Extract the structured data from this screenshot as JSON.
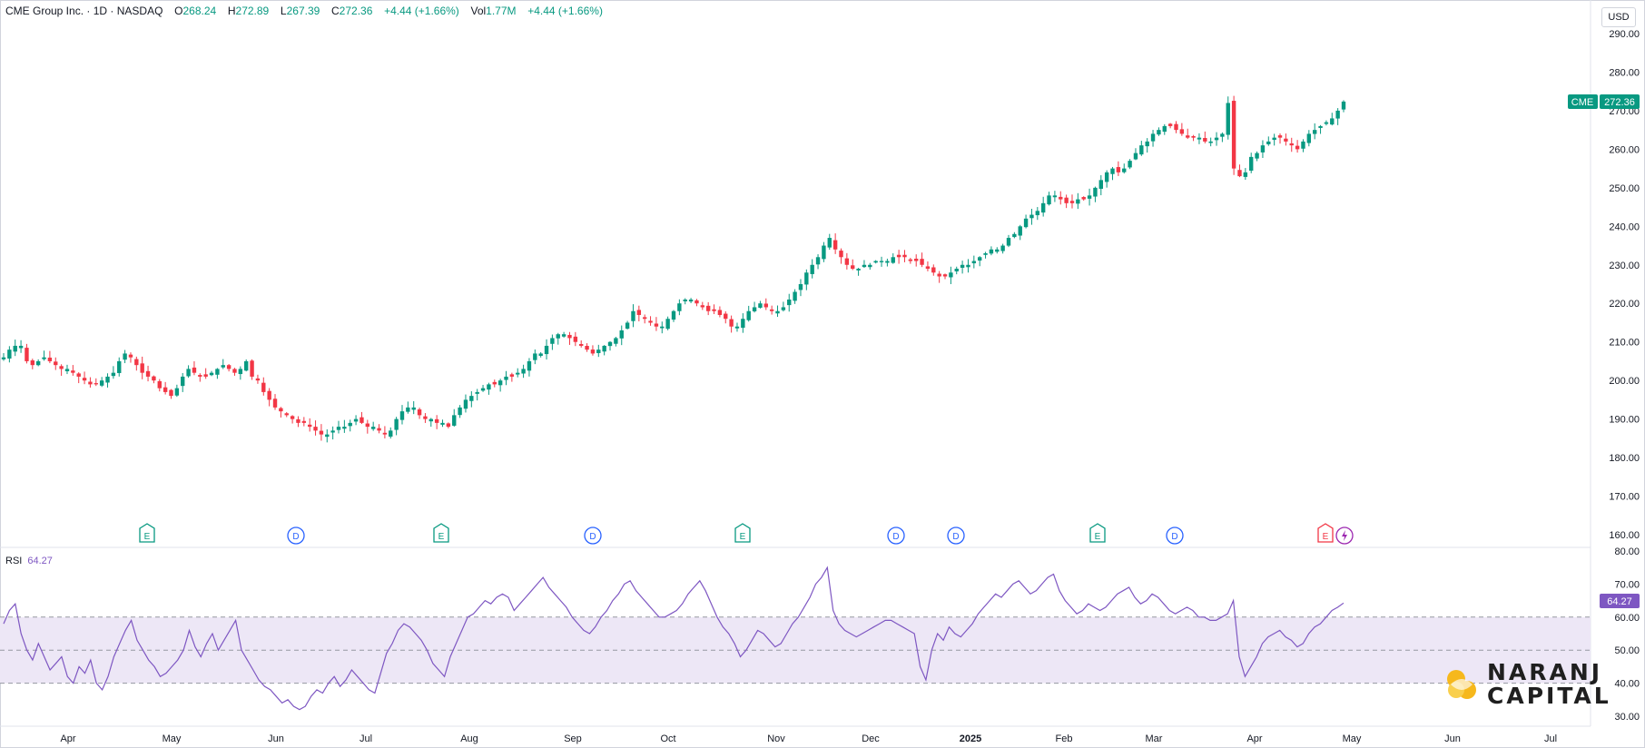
{
  "header": {
    "name": "CME Group Inc.",
    "interval": "1D",
    "exchange": "NASDAQ",
    "open_label": "O",
    "open": "268.24",
    "high_label": "H",
    "high": "272.89",
    "low_label": "L",
    "low": "267.39",
    "close_label": "C",
    "close": "272.36",
    "change": "+4.44 (+1.66%)",
    "vol_label": "Vol",
    "vol": "1.77M",
    "vol_change": "+4.44 (+1.66%)"
  },
  "currency": "USD",
  "ticker_tag": "CME",
  "last_price_label": "272.36",
  "rsi": {
    "label": "RSI",
    "value": "64.27"
  },
  "logo": {
    "line1": "NARANJ",
    "line2": "CAPITAL"
  },
  "colors": {
    "up": "#089981",
    "down": "#f23645",
    "rsi": "#7e57c2",
    "band": "#ede7f6",
    "grid": "#e0e3eb"
  },
  "chart_data": {
    "type": "candlestick",
    "price_axis": {
      "ticks": [
        "290.00",
        "280.00",
        "270.00",
        "260.00",
        "250.00",
        "240.00",
        "230.00",
        "220.00",
        "210.00",
        "200.00",
        "190.00",
        "180.00",
        "170.00",
        "160.00"
      ],
      "range": [
        158,
        292
      ]
    },
    "rsi_axis": {
      "ticks": [
        "80.00",
        "70.00",
        "60.00",
        "50.00",
        "40.00",
        "30.00"
      ],
      "range": [
        27,
        81
      ],
      "levels": [
        60,
        50,
        40
      ]
    },
    "x_labels": [
      "Apr",
      "May",
      "Jun",
      "Jul",
      "Aug",
      "Sep",
      "Oct",
      "Nov",
      "Dec",
      "2025",
      "Feb",
      "Mar",
      "Apr",
      "May",
      "Jun",
      "Jul"
    ],
    "x_label_bold": "2025",
    "close_series": [
      206,
      208,
      209,
      209,
      205,
      204,
      205,
      206,
      205,
      204,
      203,
      203,
      202,
      201,
      200,
      199,
      199,
      200,
      201,
      202,
      205,
      207,
      206,
      204,
      202,
      201,
      200,
      198,
      197,
      196,
      198,
      201,
      203,
      202,
      201,
      201,
      202,
      203,
      204,
      203,
      202,
      203,
      205,
      201,
      200,
      197,
      195,
      193,
      192,
      191,
      190,
      189,
      189,
      188,
      187,
      186,
      186,
      187,
      188,
      188,
      189,
      190,
      189,
      188,
      188,
      187,
      186,
      187,
      190,
      192,
      193,
      193,
      191,
      190,
      190,
      189,
      189,
      188,
      191,
      193,
      195,
      196,
      197,
      198,
      199,
      199,
      200,
      201,
      201,
      202,
      203,
      205,
      207,
      207,
      209,
      211,
      212,
      212,
      211,
      210,
      209,
      208,
      207,
      208,
      209,
      210,
      211,
      213,
      215,
      218,
      217,
      216,
      215,
      214,
      214,
      216,
      218,
      220,
      221,
      221,
      220,
      219,
      218,
      218,
      217,
      216,
      214,
      214,
      216,
      218,
      219,
      220,
      219,
      218,
      218,
      219,
      221,
      223,
      225,
      228,
      230,
      232,
      235,
      237,
      234,
      232,
      230,
      229,
      229,
      230,
      230,
      231,
      231,
      231,
      232,
      232,
      232,
      231,
      231,
      230,
      229,
      228,
      227,
      227,
      228,
      229,
      230,
      230,
      231,
      232,
      233,
      234,
      234,
      235,
      237,
      238,
      240,
      242,
      243,
      244,
      246,
      248,
      248,
      247,
      246,
      246,
      247,
      247,
      248,
      250,
      252,
      254,
      255,
      254,
      255,
      257,
      259,
      261,
      262,
      264,
      265,
      266,
      266,
      265,
      264,
      263,
      263,
      263,
      262,
      262,
      263,
      264,
      272,
      255,
      253,
      254,
      258,
      259,
      261,
      262,
      263,
      263,
      262,
      261,
      260,
      262,
      264,
      265,
      266,
      267,
      268,
      270,
      272.36
    ],
    "rsi_series": [
      58,
      62,
      64,
      55,
      50,
      47,
      52,
      48,
      44,
      46,
      48,
      42,
      40,
      45,
      43,
      47,
      40,
      38,
      42,
      48,
      52,
      56,
      59,
      53,
      50,
      47,
      45,
      42,
      43,
      45,
      47,
      50,
      56,
      51,
      48,
      52,
      55,
      50,
      53,
      56,
      59,
      50,
      47,
      44,
      41,
      39,
      38,
      36,
      34,
      35,
      33,
      32,
      33,
      36,
      38,
      37,
      40,
      42,
      39,
      41,
      44,
      42,
      40,
      38,
      37,
      43,
      49,
      52,
      56,
      58,
      57,
      55,
      53,
      50,
      46,
      44,
      42,
      48,
      52,
      56,
      60,
      61,
      63,
      65,
      64,
      66,
      67,
      66,
      62,
      64,
      66,
      68,
      70,
      72,
      69,
      67,
      65,
      63,
      60,
      58,
      56,
      55,
      57,
      60,
      62,
      65,
      67,
      70,
      71,
      68,
      66,
      64,
      62,
      60,
      60,
      61,
      62,
      64,
      67,
      69,
      71,
      68,
      64,
      60,
      57,
      55,
      52,
      48,
      50,
      53,
      56,
      55,
      53,
      51,
      52,
      55,
      58,
      60,
      63,
      66,
      70,
      72,
      75,
      62,
      58,
      56,
      55,
      54,
      55,
      56,
      57,
      58,
      59,
      59,
      58,
      57,
      56,
      55,
      45,
      41,
      50,
      55,
      53,
      57,
      55,
      54,
      56,
      58,
      61,
      63,
      65,
      67,
      66,
      68,
      70,
      71,
      69,
      67,
      68,
      70,
      72,
      73,
      68,
      65,
      63,
      61,
      62,
      64,
      63,
      62,
      63,
      65,
      67,
      68,
      69,
      66,
      64,
      65,
      67,
      66,
      64,
      62,
      61,
      62,
      63,
      62,
      60,
      60,
      59,
      59,
      60,
      61,
      65,
      48,
      42,
      45,
      48,
      52,
      54,
      55,
      56,
      54,
      53,
      51,
      52,
      55,
      57,
      58,
      60,
      62,
      63,
      64.27
    ]
  }
}
